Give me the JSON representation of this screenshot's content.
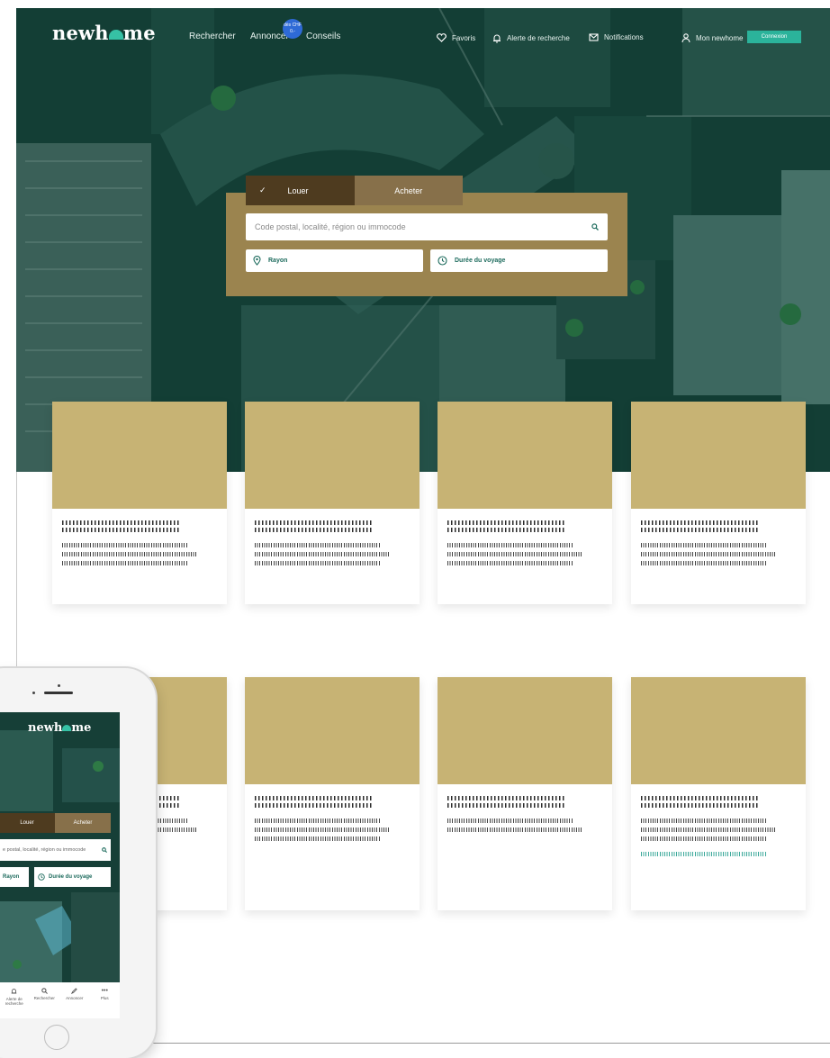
{
  "header": {
    "logo_prefix": "newh",
    "logo_suffix": "me",
    "nav": [
      "Rechercher",
      "Annoncer",
      "Conseils"
    ],
    "badge": "dès CHF 0.-",
    "favorites": "Favoris",
    "search_alert": "Alerte de recherche",
    "notifications": "Notifications",
    "account": "Mon newhome",
    "login": "Connexion"
  },
  "search": {
    "tab_rent": "Louer",
    "tab_buy": "Acheter",
    "placeholder": "Code postal, localité, région ou immocode",
    "radius": "Rayon",
    "travel_time": "Durée du voyage"
  },
  "phone": {
    "tab_rent": "Louer",
    "tab_buy": "Acheter",
    "placeholder": "e postal, localité, région ou immocode",
    "radius": "Rayon",
    "travel_time": "Durée du voyage",
    "bottom_nav": [
      "Alerte de recherche",
      "Rechercher",
      "Annoncer",
      "Plus"
    ]
  },
  "colors": {
    "accent": "#2bb39b",
    "card_image": "#c7b374",
    "panel": "#9b844f",
    "tab_active": "#4e3b1f"
  }
}
